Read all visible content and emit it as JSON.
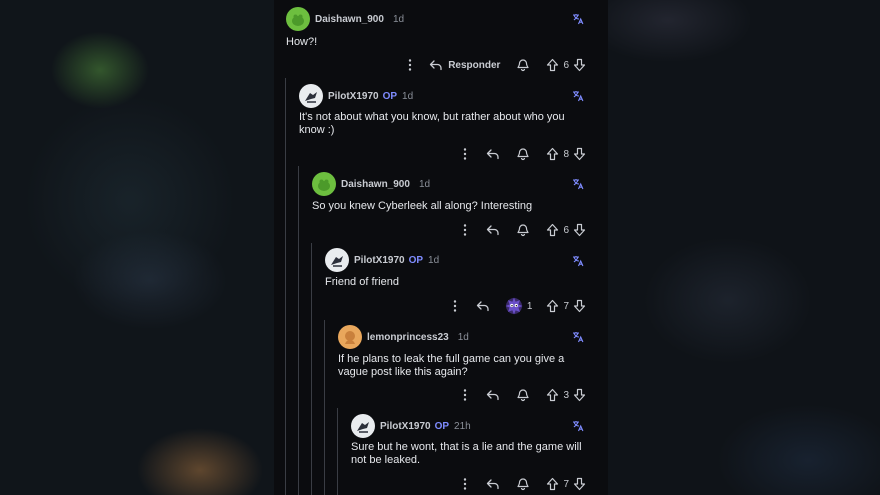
{
  "actions": {
    "more_icon": "more-vertical-icon",
    "reply_label": "Responder",
    "reply_icon": "reply-arrow-icon",
    "award_icon": "award-bell-icon",
    "upvote_icon": "arrow-up-icon",
    "downvote_icon": "arrow-down-icon",
    "translate_icon": "translate-icon"
  },
  "colors": {
    "op_badge": "#7f8cff",
    "thread_line": "#3a3d44",
    "background": "#0b0c0f"
  },
  "comments": [
    {
      "user": "Daishawn_900",
      "op": "",
      "age": "1d",
      "text": "How?!",
      "votes": "6",
      "avatar": "green"
    },
    {
      "user": "PilotX1970",
      "op": "OP",
      "age": "1d",
      "text": "It's not about what you know, but rather about who you know :)",
      "votes": "8",
      "avatar": "white"
    },
    {
      "user": "Daishawn_900",
      "op": "",
      "age": "1d",
      "text": "So you knew Cyberleek all along? Interesting",
      "votes": "6",
      "avatar": "green"
    },
    {
      "user": "PilotX1970",
      "op": "OP",
      "age": "1d",
      "text": "Friend of friend",
      "votes": "7",
      "avatar": "white",
      "award_count": "1"
    },
    {
      "user": "lemonprincess23",
      "op": "",
      "age": "1d",
      "text": "If he plans to leak the full game can you give a vague post like this again?",
      "votes": "3",
      "avatar": "orange"
    },
    {
      "user": "PilotX1970",
      "op": "OP",
      "age": "21h",
      "text": "Sure but he wont, that is a lie and the game will not be leaked.",
      "votes": "7",
      "avatar": "white"
    }
  ]
}
